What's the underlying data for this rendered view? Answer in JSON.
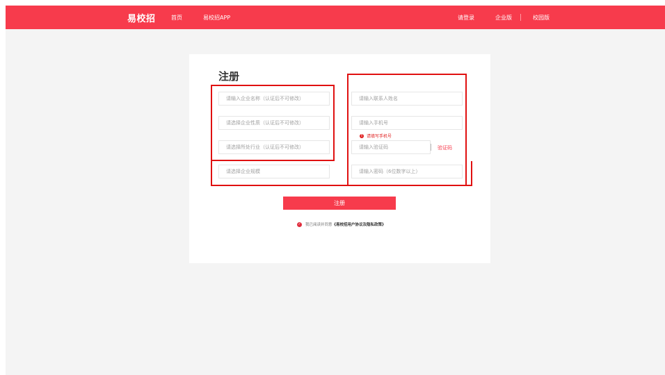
{
  "header": {
    "brand": "易校招",
    "nav": {
      "home": "首页",
      "app": "易校招APP",
      "login": "请登录",
      "enterprise": "企业版",
      "campus": "校园版"
    }
  },
  "form": {
    "title": "注册",
    "company_name_placeholder": "请输入企业名称（认证后不可修改）",
    "company_nature_placeholder": "请选择企业性质（认证后不可修改）",
    "industry_placeholder": "请选择所处行业（认证后不可修改）",
    "scale_placeholder": "请选择企业规模",
    "contact_name_placeholder": "请输入联系人姓名",
    "phone_placeholder": "请输入手机号",
    "phone_error": "请填写手机号",
    "code_placeholder": "请输入验证码",
    "get_code": "验证码",
    "password_placeholder": "请输入密码（6位数字以上）",
    "register_button": "注册",
    "agree_prefix": "我已阅读并同意",
    "agree_link": "《易校招用户协议及隐私政策》"
  },
  "colors": {
    "brand_red": "#f73b4c",
    "annotation_red": "#e01010",
    "page_bg": "#f4f4f4"
  }
}
